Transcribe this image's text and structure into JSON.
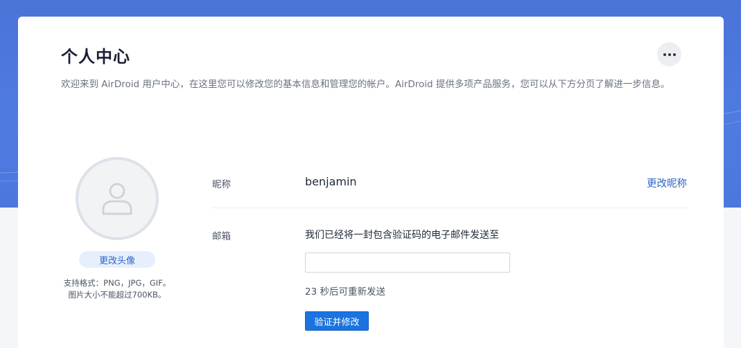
{
  "header": {
    "title": "个人中心",
    "more_icon": "more-horizontal-icon",
    "intro": "欢迎来到 AirDroid 用户中心，在这里您可以修改您的基本信息和管理您的帐户。AirDroid 提供多项产品服务，您可以从下方分页了解进一步信息。"
  },
  "avatar": {
    "icon": "user-icon",
    "change_label": "更改头像",
    "note_line1": "支持格式：PNG，JPG，GIF。",
    "note_line2": "图片大小不能超过700KB。"
  },
  "nickname": {
    "label": "昵称",
    "value": "benjamin",
    "change_link": "更改昵称"
  },
  "email": {
    "label": "邮箱",
    "message": "我们已经将一封包含验证码的电子邮件发送至",
    "input_value": "",
    "resend_text": "23 秒后可重新发送",
    "verify_button": "验证并修改"
  },
  "colors": {
    "accent": "#1a73e0",
    "link": "#2f63c8",
    "hero": "#4f7be0"
  }
}
